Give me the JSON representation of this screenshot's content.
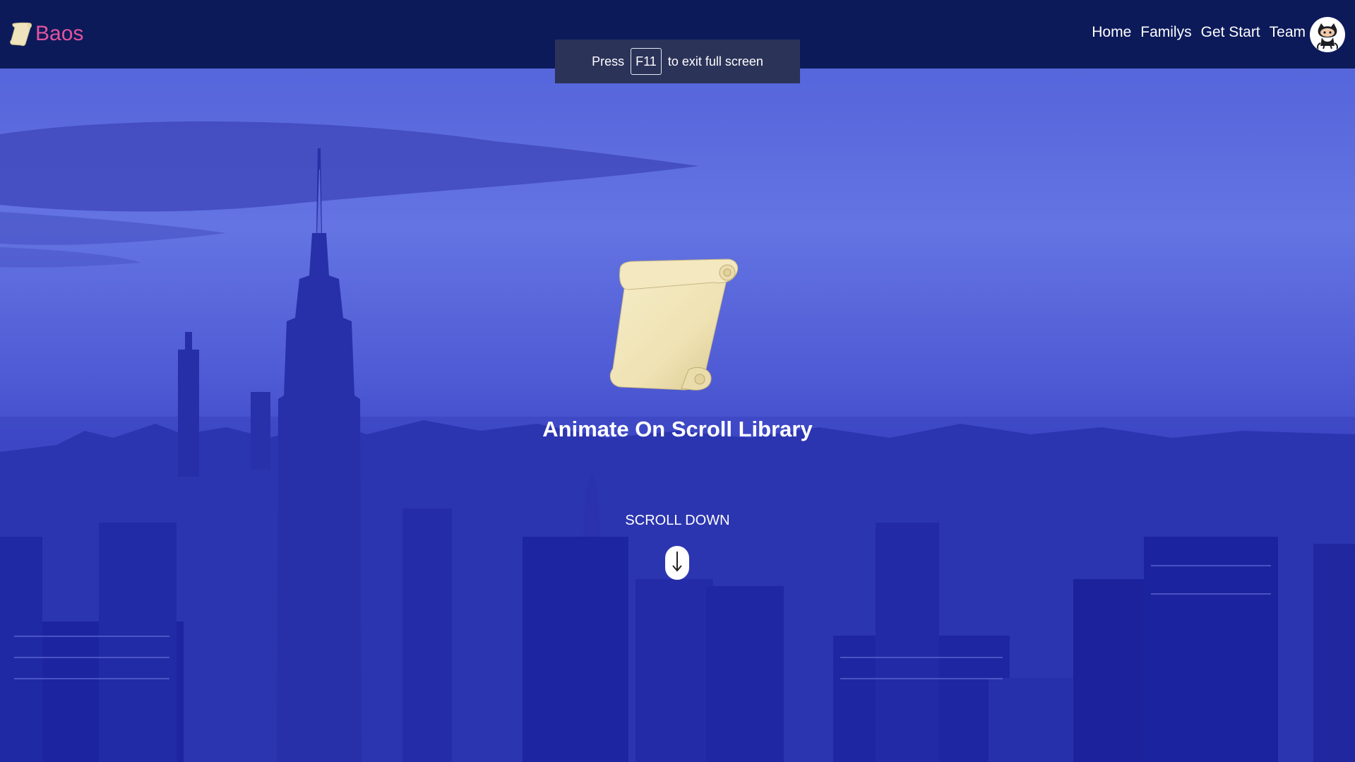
{
  "navbar": {
    "brand": {
      "logo_icon": "scroll-icon",
      "name": "Baos"
    },
    "links": [
      {
        "label": "Home"
      },
      {
        "label": "Familys"
      },
      {
        "label": "Get Start"
      },
      {
        "label": "Team"
      }
    ],
    "avatar_icon": "octocat-icon"
  },
  "fullscreen_notice": {
    "prefix": "Press",
    "key": "F11",
    "suffix": "to exit full screen"
  },
  "hero": {
    "logo_icon": "scroll-icon",
    "title": "Animate On Scroll Library",
    "scroll_label": "SCROLL DOWN",
    "scroll_icon": "arrow-down-icon"
  },
  "colors": {
    "navbar_bg": "#0c1a5a",
    "brand_text": "#e3549e",
    "hero_overlay": "#3d48c9",
    "notice_bg": "#2b3359"
  }
}
